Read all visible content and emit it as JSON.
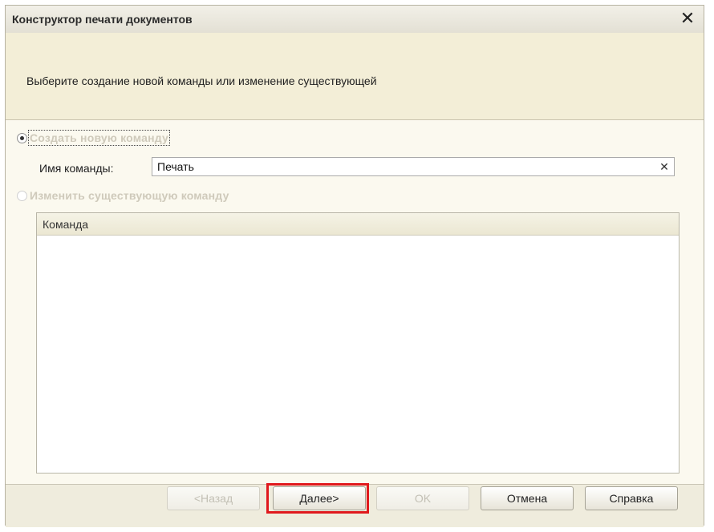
{
  "window": {
    "title": "Конструктор печати документов"
  },
  "header": {
    "instruction": "Выберите создание новой команды или изменение существующей"
  },
  "options": {
    "create_new_label": "Создать новую команду",
    "command_name_label": "Имя команды:",
    "command_name_value": "Печать",
    "edit_existing_label": "Изменить существующую команду"
  },
  "table": {
    "columns": [
      "Команда"
    ],
    "rows": []
  },
  "buttons": {
    "back": "<Назад",
    "next": "Далее>",
    "ok": "OK",
    "cancel": "Отмена",
    "help": "Справка"
  },
  "icons": {
    "close": "close-icon",
    "clear": "clear-icon"
  },
  "colors": {
    "highlight": "#e0191d"
  }
}
